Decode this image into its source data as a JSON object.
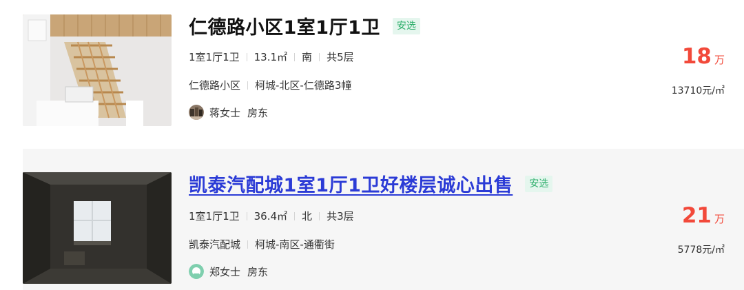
{
  "listings": [
    {
      "title": "仁德路小区1室1厅1卫",
      "badge": "安选",
      "layout": "1室1厅1卫",
      "area": "13.1㎡",
      "orientation": "南",
      "floors": "共5层",
      "community": "仁德路小区",
      "location": "柯城-北区-仁德路3幢",
      "agent_name": "蒋女士",
      "agent_role": "房东",
      "price": "18",
      "price_unit": "万",
      "unit_price": "13710元/㎡"
    },
    {
      "title": "凯泰汽配城1室1厅1卫好楼层诚心出售",
      "badge": "安选",
      "layout": "1室1厅1卫",
      "area": "36.4㎡",
      "orientation": "北",
      "floors": "共3层",
      "community": "凯泰汽配城",
      "location": "柯城-南区-通衢街",
      "agent_name": "郑女士",
      "agent_role": "房东",
      "price": "21",
      "price_unit": "万",
      "unit_price": "5778元/㎡"
    }
  ],
  "colors": {
    "price": "#f2493a",
    "badge_text": "#2cae6a",
    "badge_bg": "#e5f6ee",
    "link": "#2b3bd6"
  }
}
